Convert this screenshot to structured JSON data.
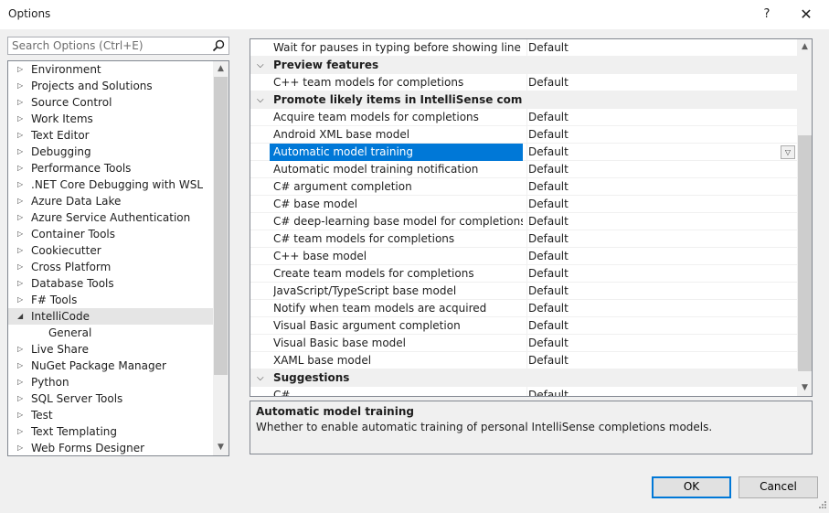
{
  "window": {
    "title": "Options",
    "help_glyph": "?",
    "close_glyph": "✕"
  },
  "search": {
    "placeholder": "Search Options (Ctrl+E)"
  },
  "tree": {
    "items": [
      {
        "label": "Environment",
        "state": "collapsed"
      },
      {
        "label": "Projects and Solutions",
        "state": "collapsed"
      },
      {
        "label": "Source Control",
        "state": "collapsed"
      },
      {
        "label": "Work Items",
        "state": "collapsed"
      },
      {
        "label": "Text Editor",
        "state": "collapsed"
      },
      {
        "label": "Debugging",
        "state": "collapsed"
      },
      {
        "label": "Performance Tools",
        "state": "collapsed"
      },
      {
        "label": ".NET Core Debugging with WSL",
        "state": "collapsed"
      },
      {
        "label": "Azure Data Lake",
        "state": "collapsed"
      },
      {
        "label": "Azure Service Authentication",
        "state": "collapsed"
      },
      {
        "label": "Container Tools",
        "state": "collapsed"
      },
      {
        "label": "Cookiecutter",
        "state": "collapsed"
      },
      {
        "label": "Cross Platform",
        "state": "collapsed"
      },
      {
        "label": "Database Tools",
        "state": "collapsed"
      },
      {
        "label": "F# Tools",
        "state": "collapsed"
      },
      {
        "label": "IntelliCode",
        "state": "expanded",
        "selected": true
      },
      {
        "label": "General",
        "state": "child"
      },
      {
        "label": "Live Share",
        "state": "collapsed"
      },
      {
        "label": "NuGet Package Manager",
        "state": "collapsed"
      },
      {
        "label": "Python",
        "state": "collapsed"
      },
      {
        "label": "SQL Server Tools",
        "state": "collapsed"
      },
      {
        "label": "Test",
        "state": "collapsed"
      },
      {
        "label": "Text Templating",
        "state": "collapsed"
      },
      {
        "label": "Web Forms Designer",
        "state": "collapsed"
      }
    ]
  },
  "grid": {
    "rows": [
      {
        "type": "prop",
        "name": "Wait for pauses in typing before showing line completions",
        "value": "Default"
      },
      {
        "type": "cat",
        "name": "Preview features"
      },
      {
        "type": "prop",
        "name": "C++ team models for completions",
        "value": "Default"
      },
      {
        "type": "cat",
        "name": "Promote likely items in IntelliSense completion lists"
      },
      {
        "type": "prop",
        "name": "Acquire team models for completions",
        "value": "Default"
      },
      {
        "type": "prop",
        "name": "Android XML base model",
        "value": "Default"
      },
      {
        "type": "prop",
        "name": "Automatic model training",
        "value": "Default",
        "selected": true
      },
      {
        "type": "prop",
        "name": "Automatic model training notification",
        "value": "Default"
      },
      {
        "type": "prop",
        "name": "C# argument completion",
        "value": "Default"
      },
      {
        "type": "prop",
        "name": "C# base model",
        "value": "Default"
      },
      {
        "type": "prop",
        "name": "C# deep-learning base model for completions",
        "value": "Default"
      },
      {
        "type": "prop",
        "name": "C# team models for completions",
        "value": "Default"
      },
      {
        "type": "prop",
        "name": "C++ base model",
        "value": "Default"
      },
      {
        "type": "prop",
        "name": "Create team models for completions",
        "value": "Default"
      },
      {
        "type": "prop",
        "name": "JavaScript/TypeScript base model",
        "value": "Default"
      },
      {
        "type": "prop",
        "name": "Notify when team models are acquired",
        "value": "Default"
      },
      {
        "type": "prop",
        "name": "Visual Basic argument completion",
        "value": "Default"
      },
      {
        "type": "prop",
        "name": "Visual Basic base model",
        "value": "Default"
      },
      {
        "type": "prop",
        "name": "XAML base model",
        "value": "Default"
      },
      {
        "type": "cat",
        "name": "Suggestions"
      },
      {
        "type": "prop",
        "name": "C#",
        "value": "Default"
      }
    ]
  },
  "description": {
    "title": "Automatic model training",
    "text": "Whether to enable automatic training of personal IntelliSense completions models."
  },
  "buttons": {
    "ok": "OK",
    "cancel": "Cancel"
  },
  "colors": {
    "selection": "#0078d7",
    "tree_selection": "#e5e5e5",
    "default_button_border": "#0078d7"
  },
  "icons": {
    "search": "magnifier-icon",
    "dropdown": "chevron-down-icon"
  }
}
